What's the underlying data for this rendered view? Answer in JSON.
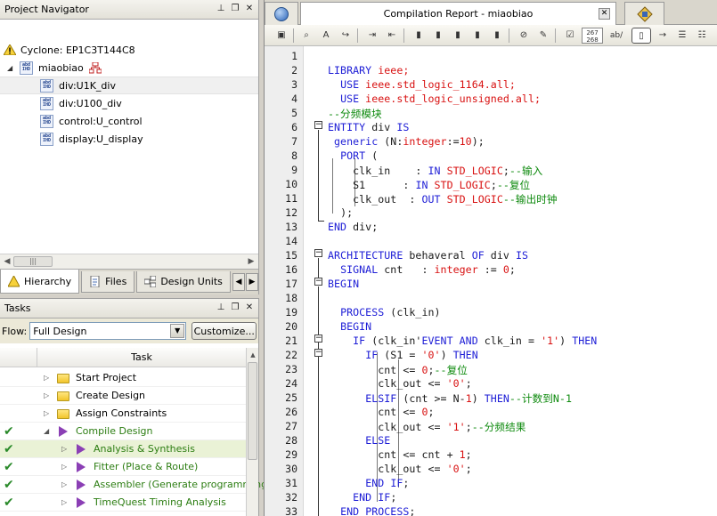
{
  "navigator": {
    "title": "Project Navigator",
    "device": "Cyclone: EP1C3T144C8",
    "top_entity": "miaobiao",
    "instances": [
      "div:U1K_div",
      "div:U100_div",
      "control:U_control",
      "display:U_display"
    ],
    "tabs": [
      "Hierarchy",
      "Files",
      "Design Units"
    ]
  },
  "tasks": {
    "title": "Tasks",
    "flow_label": "Flow:",
    "flow_value": "Full Design",
    "customize_label": "Customize...",
    "column_header": "Task",
    "rows": [
      {
        "label": "Start Project",
        "done": false
      },
      {
        "label": "Create Design",
        "done": false
      },
      {
        "label": "Assign Constraints",
        "done": false
      },
      {
        "label": "Compile Design",
        "done": true
      },
      {
        "label": "Analysis & Synthesis",
        "done": true
      },
      {
        "label": "Fitter (Place & Route)",
        "done": true
      },
      {
        "label": "Assembler (Generate programming",
        "done": true
      },
      {
        "label": "TimeQuest Timing Analysis",
        "done": true
      }
    ]
  },
  "editor": {
    "tab_title": "Compilation Report - miaobiao",
    "toolbar_badge_top": "267",
    "toolbar_badge_bottom": "268",
    "toolbar_ab": "ab/",
    "line_numbers": [
      "1",
      "2",
      "3",
      "4",
      "5",
      "6",
      "7",
      "8",
      "9",
      "10",
      "11",
      "12",
      "13",
      "14",
      "15",
      "16",
      "17",
      "18",
      "19",
      "20",
      "21",
      "22",
      "23",
      "24",
      "25",
      "26",
      "27",
      "28",
      "29",
      "30",
      "31",
      "32",
      "33"
    ],
    "code": {
      "l2_a": "LIBRARY",
      "l2_b": " ieee;",
      "l3_a": "USE",
      "l3_b": " ieee.std_logic_1164.all;",
      "l4_a": "USE",
      "l4_b": " ieee.std_logic_unsigned.all;",
      "l5": "--分频模块",
      "l6_a": "ENTITY",
      "l6_b": " div ",
      "l6_c": "IS",
      "l7_a": "generic",
      "l7_b": " (N:",
      "l7_c": "integer",
      "l7_d": ":=",
      "l7_e": "10",
      "l7_f": ");",
      "l8_a": "PORT",
      "l8_b": " (",
      "l9_a": "clk_in    : ",
      "l9_b": "IN",
      "l9_c": " ",
      "l9_d": "STD_LOGIC",
      "l9_e": ";",
      "l9_f": "--输入",
      "l10_a": "S1      : ",
      "l10_b": "IN",
      "l10_c": " ",
      "l10_d": "STD_LOGIC",
      "l10_e": ";",
      "l10_f": "--复位",
      "l11_a": "clk_out  : ",
      "l11_b": "OUT",
      "l11_c": " ",
      "l11_d": "STD_LOGIC",
      "l11_f": "--输出时钟",
      "l12": ");",
      "l13_a": "END",
      "l13_b": " div;",
      "l15_a": "ARCHITECTURE",
      "l15_b": " behaveral ",
      "l15_c": "OF",
      "l15_d": " div ",
      "l15_e": "IS",
      "l16_a": "SIGNAL",
      "l16_b": " cnt   : ",
      "l16_c": "integer",
      "l16_d": " := ",
      "l16_e": "0",
      "l16_f": ";",
      "l17": "BEGIN",
      "l19_a": "PROCESS",
      "l19_b": " (clk_in)",
      "l20": "BEGIN",
      "l21_a": "IF",
      "l21_b": " (clk_in'",
      "l21_c": "EVENT",
      "l21_d": " ",
      "l21_e": "AND",
      "l21_f": " clk_in = ",
      "l21_g": "'1'",
      "l21_h": ") ",
      "l21_i": "THEN",
      "l22_a": "IF",
      "l22_b": " (S1 = ",
      "l22_c": "'0'",
      "l22_d": ") ",
      "l22_e": "THEN",
      "l23_a": "cnt <= ",
      "l23_b": "0",
      "l23_c": ";",
      "l23_d": "--复位",
      "l24_a": "clk_out <= ",
      "l24_b": "'0'",
      "l24_c": ";",
      "l25_a": "ELSIF",
      "l25_b": " (cnt >= N-",
      "l25_c": "1",
      "l25_d": ") ",
      "l25_e": "THEN",
      "l25_f": "--计数到N-1",
      "l26_a": "cnt <= ",
      "l26_b": "0",
      "l26_c": ";",
      "l27_a": "clk_out <= ",
      "l27_b": "'1'",
      "l27_c": ";",
      "l27_d": "--分频结果",
      "l28": "ELSE",
      "l29_a": "cnt <= cnt + ",
      "l29_b": "1",
      "l29_c": ";",
      "l30_a": "clk_out <= ",
      "l30_b": "'0'",
      "l30_c": ";",
      "l31_a": "END",
      "l31_b": " ",
      "l31_c": "IF",
      "l31_d": ";",
      "l32_a": "END",
      "l32_b": " ",
      "l32_c": "IF",
      "l32_d": ";",
      "l33_a": "END",
      "l33_b": " ",
      "l33_c": "PROCESS",
      "l33_d": ";"
    }
  }
}
